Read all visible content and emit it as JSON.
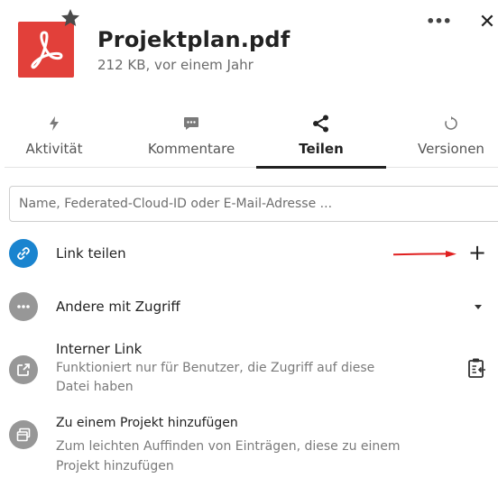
{
  "header": {
    "file_name": "Projektplan.pdf",
    "file_meta": "212 KB, vor einem Jahr",
    "file_icon": "pdf-icon",
    "favorite_icon": "star-icon",
    "more_icon": "more-icon",
    "close_icon": "close-icon",
    "more_glyph": "•••",
    "close_glyph": "✕"
  },
  "tabs": [
    {
      "label": "Aktivität",
      "icon": "activity-icon",
      "active": false
    },
    {
      "label": "Kommentare",
      "icon": "comment-icon",
      "active": false
    },
    {
      "label": "Teilen",
      "icon": "share-icon",
      "active": true
    },
    {
      "label": "Versionen",
      "icon": "history-icon",
      "active": false
    }
  ],
  "search": {
    "placeholder": "Name, Federated-Cloud-ID oder E-Mail-Adresse ..."
  },
  "rows": {
    "link_share": {
      "title": "Link teilen",
      "action": "+"
    },
    "others_access": {
      "title": "Andere mit Zugriff"
    },
    "internal_link": {
      "title": "Interner Link",
      "sub_line1": "Funktioniert nur für Benutzer, die Zugriff auf diese",
      "sub_line2": "Datei haben"
    },
    "project": {
      "title": "Zu einem Projekt hinzufügen",
      "sub_line1": "Zum leichten Auffinden von Einträgen, diese zu einem",
      "sub_line2": "Projekt hinzufügen"
    }
  },
  "colors": {
    "pdf_red": "#e2403a",
    "link_blue": "#1a84cf",
    "avatar_grey": "#979797",
    "annotation_arrow": "#e02020"
  }
}
